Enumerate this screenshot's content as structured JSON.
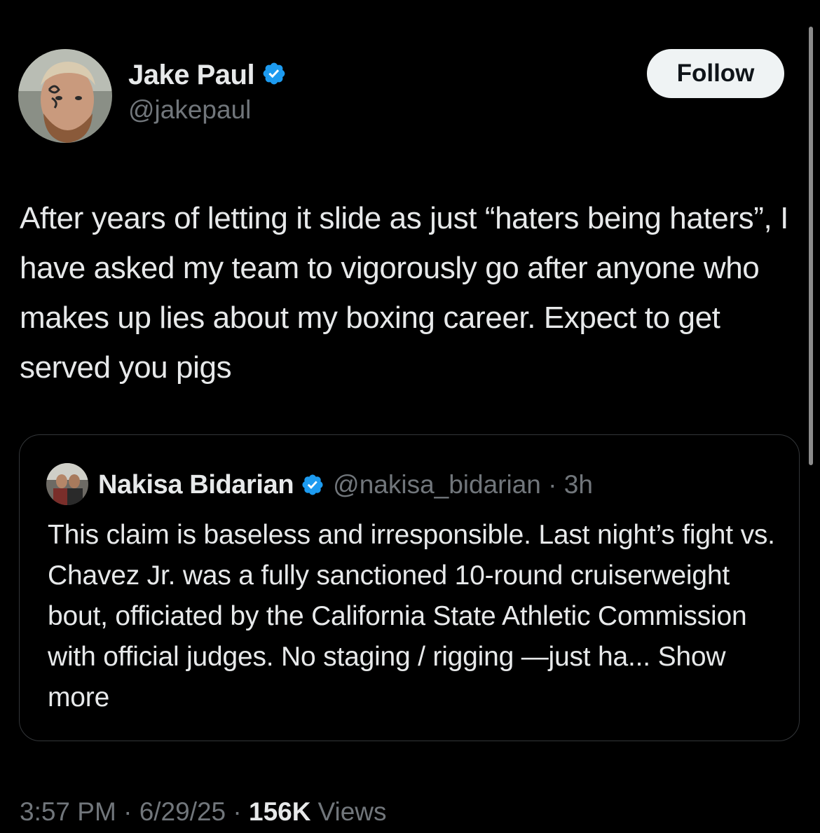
{
  "tweet": {
    "author": {
      "name": "Jake Paul",
      "handle": "@jakepaul",
      "verified": true,
      "avatar": "profile-photo"
    },
    "follow_label": "Follow",
    "text": "After years of letting it slide as just “haters being haters”, I have asked my team to vigorously go after anyone who makes up lies about my boxing career. Expect to get served you pigs",
    "quoted": {
      "name": "Nakisa Bidarian",
      "handle_time": "@nakisa_bidarian · 3h",
      "verified": true,
      "text": "This claim is baseless and irresponsible.  Last night’s fight vs. Chavez Jr. was a fully sanctioned 10-round cruiserweight bout, officiated by the California State Athletic Commission with official judges.  No staging / rigging —just ha...",
      "show_more": "Show more"
    },
    "meta": {
      "time": "3:57 PM",
      "sep1": " · ",
      "date": "6/29/25",
      "sep2": " · ",
      "views_count": "156K",
      "views_label": "Views"
    }
  },
  "colors": {
    "background": "#000000",
    "text": "#e7e9ea",
    "muted": "#71767b",
    "verified_blue": "#1d9bf0",
    "follow_bg": "#eff3f4",
    "border": "#333639"
  }
}
